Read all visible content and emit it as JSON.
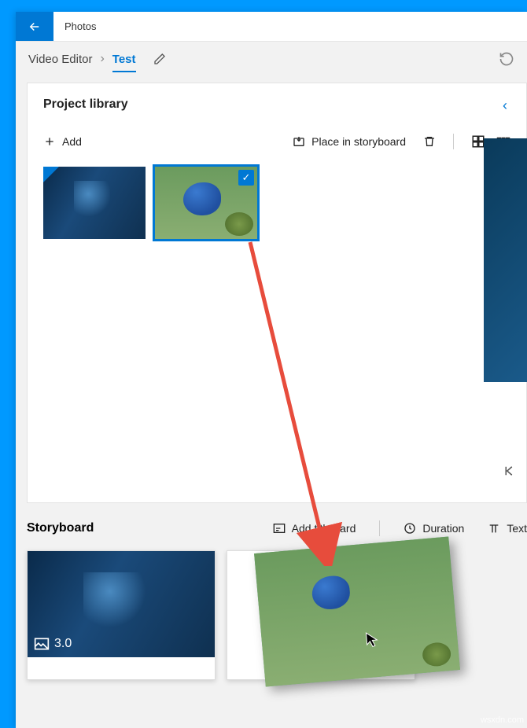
{
  "app": {
    "title": "Photos"
  },
  "breadcrumb": {
    "root": "Video Editor",
    "current": "Test"
  },
  "library": {
    "title": "Project library",
    "add_label": "Add",
    "place_label": "Place in storyboard",
    "thumbs": [
      {
        "name": "gaming-clip",
        "selected": false
      },
      {
        "name": "bird-photo",
        "selected": true
      }
    ]
  },
  "storyboard": {
    "title": "Storyboard",
    "title_card_label": "Add title card",
    "duration_label": "Duration",
    "text_label": "Text",
    "clips": [
      {
        "name": "gaming-clip",
        "duration": "3.0"
      }
    ]
  }
}
